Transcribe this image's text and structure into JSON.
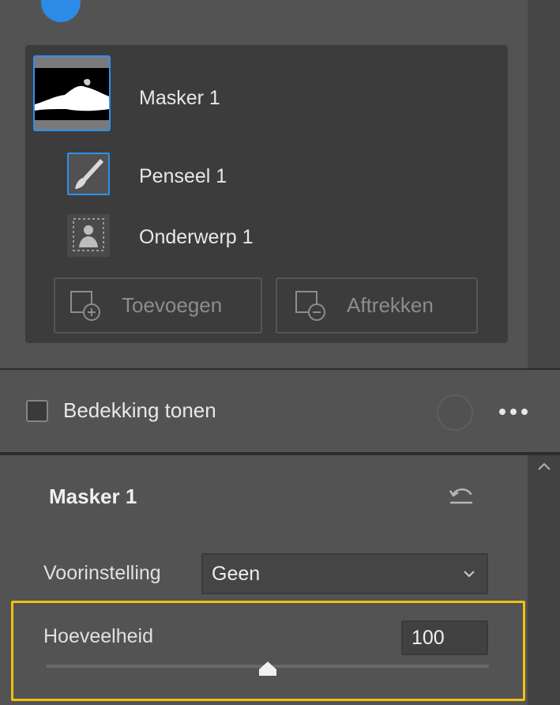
{
  "masks": {
    "main_mask_label": "Masker 1",
    "components": [
      {
        "label": "Penseel 1",
        "icon": "brush-icon"
      },
      {
        "label": "Onderwerp 1",
        "icon": "subject-icon"
      }
    ],
    "add_button_label": "Toevoegen",
    "subtract_button_label": "Aftrekken"
  },
  "overlay": {
    "checkbox_label": "Bedekking tonen",
    "checked": false
  },
  "properties": {
    "title": "Masker 1",
    "preset_label": "Voorinstelling",
    "preset_value": "Geen",
    "amount_label": "Hoeveelheid",
    "amount_value": "100",
    "amount_slider_fraction": 0.5
  },
  "colors": {
    "accent_blue": "#2e8ff0",
    "highlight_yellow": "#f2c00e",
    "panel_bg": "#535353",
    "inner_panel_bg": "#3c3c3c"
  }
}
